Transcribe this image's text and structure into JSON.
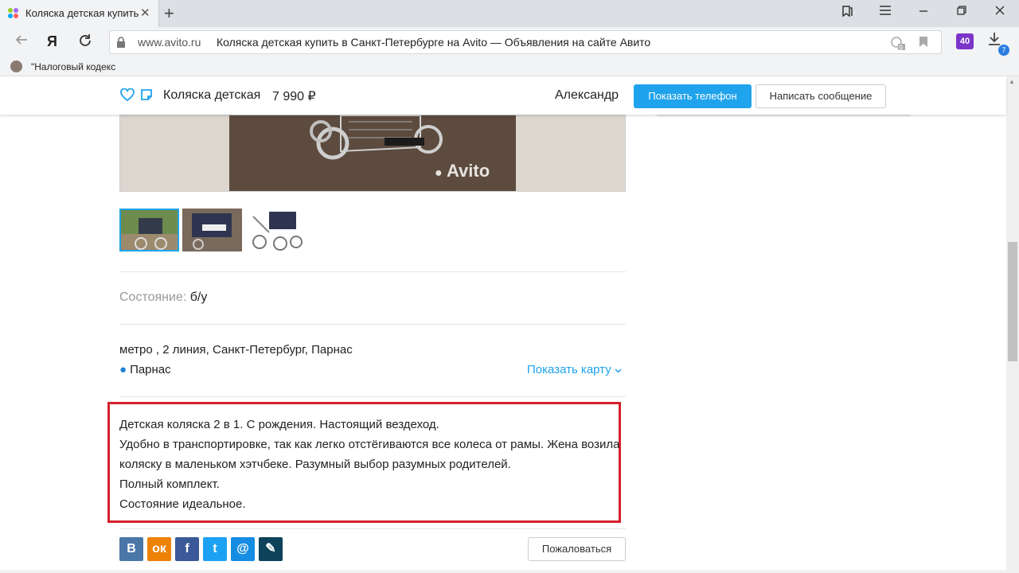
{
  "browser": {
    "tab_title": "Коляска детская купить",
    "tab_close": "✕",
    "new_tab": "+",
    "address_host": "www.avito.ru",
    "address_title": "Коляска детская купить в Санкт-Петербурге на Avito — Объявления на сайте Авито",
    "ext_label": "40",
    "download_badge": "7",
    "bookmark_label": "\"Налоговый кодекс",
    "translate_badge": "9"
  },
  "sticky_header": {
    "item_name": "Коляска детская",
    "price": "7 990 ₽",
    "seller": "Александр",
    "show_phone": "Показать телефон",
    "write_message": "Написать сообщение"
  },
  "photo": {
    "watermark": "Avito"
  },
  "details": {
    "condition_label": "Состояние:",
    "condition_value": "б/у",
    "address": "метро , 2 линия, Санкт-Петербург, Парнас",
    "metro": "Парнас",
    "show_map": "Показать карту"
  },
  "description": [
    "Детская коляска 2 в 1. С рождения. Настоящий вездеход.",
    "Удобно в транспортировке, так как легко отстёгиваются все колеса от рамы. Жена возила коляску в маленьком хэтчбеке. Разумный выбор разумных родителей.",
    "Полный комплект.",
    "Состояние идеальное."
  ],
  "share": {
    "vk": "B",
    "ok": "ок",
    "fb": "f",
    "tw": "t",
    "mail": "@",
    "lj": "✎",
    "report": "Пожаловаться"
  },
  "colors": {
    "accent_blue": "#1fa3ec",
    "highlight_red": "#d6202d",
    "vk": "#4a76a8",
    "ok": "#ee8208",
    "fb": "#3b5998",
    "tw": "#1da1f2",
    "mail": "#168de2",
    "lj": "#0d425a"
  }
}
